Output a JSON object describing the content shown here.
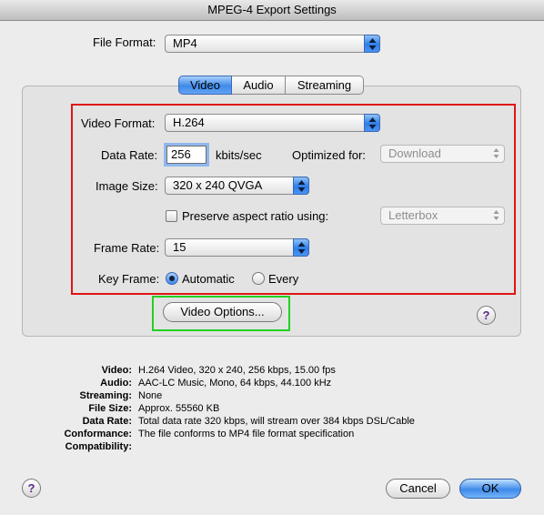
{
  "window": {
    "title": "MPEG-4 Export Settings"
  },
  "file_format": {
    "label": "File Format:",
    "value": "MP4"
  },
  "tabs": [
    {
      "label": "Video",
      "active": true
    },
    {
      "label": "Audio",
      "active": false
    },
    {
      "label": "Streaming",
      "active": false
    }
  ],
  "video": {
    "format_label": "Video Format:",
    "format_value": "H.264",
    "data_rate_label": "Data Rate:",
    "data_rate_value": "256",
    "data_rate_unit": "kbits/sec",
    "optimized_label": "Optimized for:",
    "optimized_value": "Download",
    "image_size_label": "Image Size:",
    "image_size_value": "320 x 240 QVGA",
    "preserve_label": "Preserve aspect ratio using:",
    "preserve_checked": false,
    "preserve_value": "Letterbox",
    "frame_rate_label": "Frame Rate:",
    "frame_rate_value": "15",
    "key_frame_label": "Key Frame:",
    "key_frame_automatic": "Automatic",
    "key_frame_every": "Every",
    "options_button": "Video Options..."
  },
  "help_glyph": "?",
  "summary": [
    {
      "key": "Video:",
      "value": "H.264 Video, 320 x 240, 256 kbps, 15.00 fps"
    },
    {
      "key": "Audio:",
      "value": "AAC-LC Music, Mono, 64 kbps, 44.100 kHz"
    },
    {
      "key": "Streaming:",
      "value": "None"
    },
    {
      "key": "File Size:",
      "value": "Approx. 55560 KB"
    },
    {
      "key": "Data Rate:",
      "value": "Total data rate 320 kbps, will stream over 384 kbps DSL/Cable"
    },
    {
      "key": "Conformance:",
      "value": "The file conforms to MP4 file format specification"
    },
    {
      "key": "Compatibility:",
      "value": ""
    }
  ],
  "buttons": {
    "cancel": "Cancel",
    "ok": "OK"
  },
  "colors": {
    "highlight_red": "#e01414",
    "highlight_green": "#22d022",
    "accent_blue": "#3f8ae9"
  },
  "icons": {
    "popup_arrows": "up-down-arrows-icon",
    "help": "help-icon"
  }
}
